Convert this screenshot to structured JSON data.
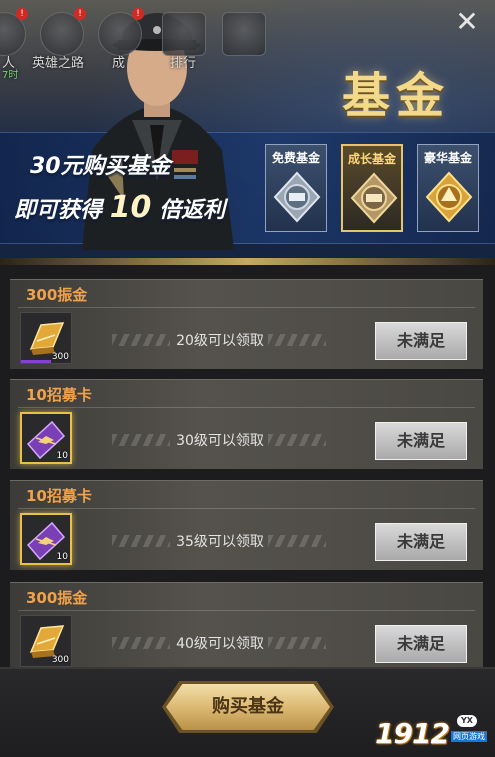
{
  "top_nav": {
    "items": [
      {
        "label": "人",
        "badge": "!",
        "sub": "7时"
      },
      {
        "label": "英雄之路",
        "badge": "!"
      },
      {
        "label": "成",
        "badge": "!"
      },
      {
        "label": "排行"
      },
      {
        "label": ""
      }
    ]
  },
  "banner": {
    "title": "基金",
    "promo_line1": "30元购买基金",
    "promo_line2_prefix": "即可获得",
    "promo_line2_number": "10",
    "promo_line2_suffix": "倍返利",
    "tiers": [
      {
        "label": "免费基金",
        "active": false
      },
      {
        "label": "成长基金",
        "active": true
      },
      {
        "label": "豪华基金",
        "active": false
      }
    ]
  },
  "rewards": [
    {
      "title": "300振金",
      "item": "gold-bar",
      "qty": "300",
      "condition": "20级可以领取",
      "status": "未满足"
    },
    {
      "title": "10招募卡",
      "item": "recruit-card",
      "qty": "10",
      "condition": "30级可以领取",
      "status": "未满足"
    },
    {
      "title": "10招募卡",
      "item": "recruit-card",
      "qty": "10",
      "condition": "35级可以领取",
      "status": "未满足"
    },
    {
      "title": "300振金",
      "item": "gold-bar",
      "qty": "300",
      "condition": "40级可以领取",
      "status": "未满足"
    }
  ],
  "footer": {
    "buy_label": "购买基金"
  },
  "watermark": {
    "number": "1912",
    "yx": "YX",
    "sub": "网页游戏"
  },
  "colors": {
    "accent_gold": "#f3d98a",
    "item_title": "#f0a24a",
    "status_button": "#c4c4c4"
  }
}
